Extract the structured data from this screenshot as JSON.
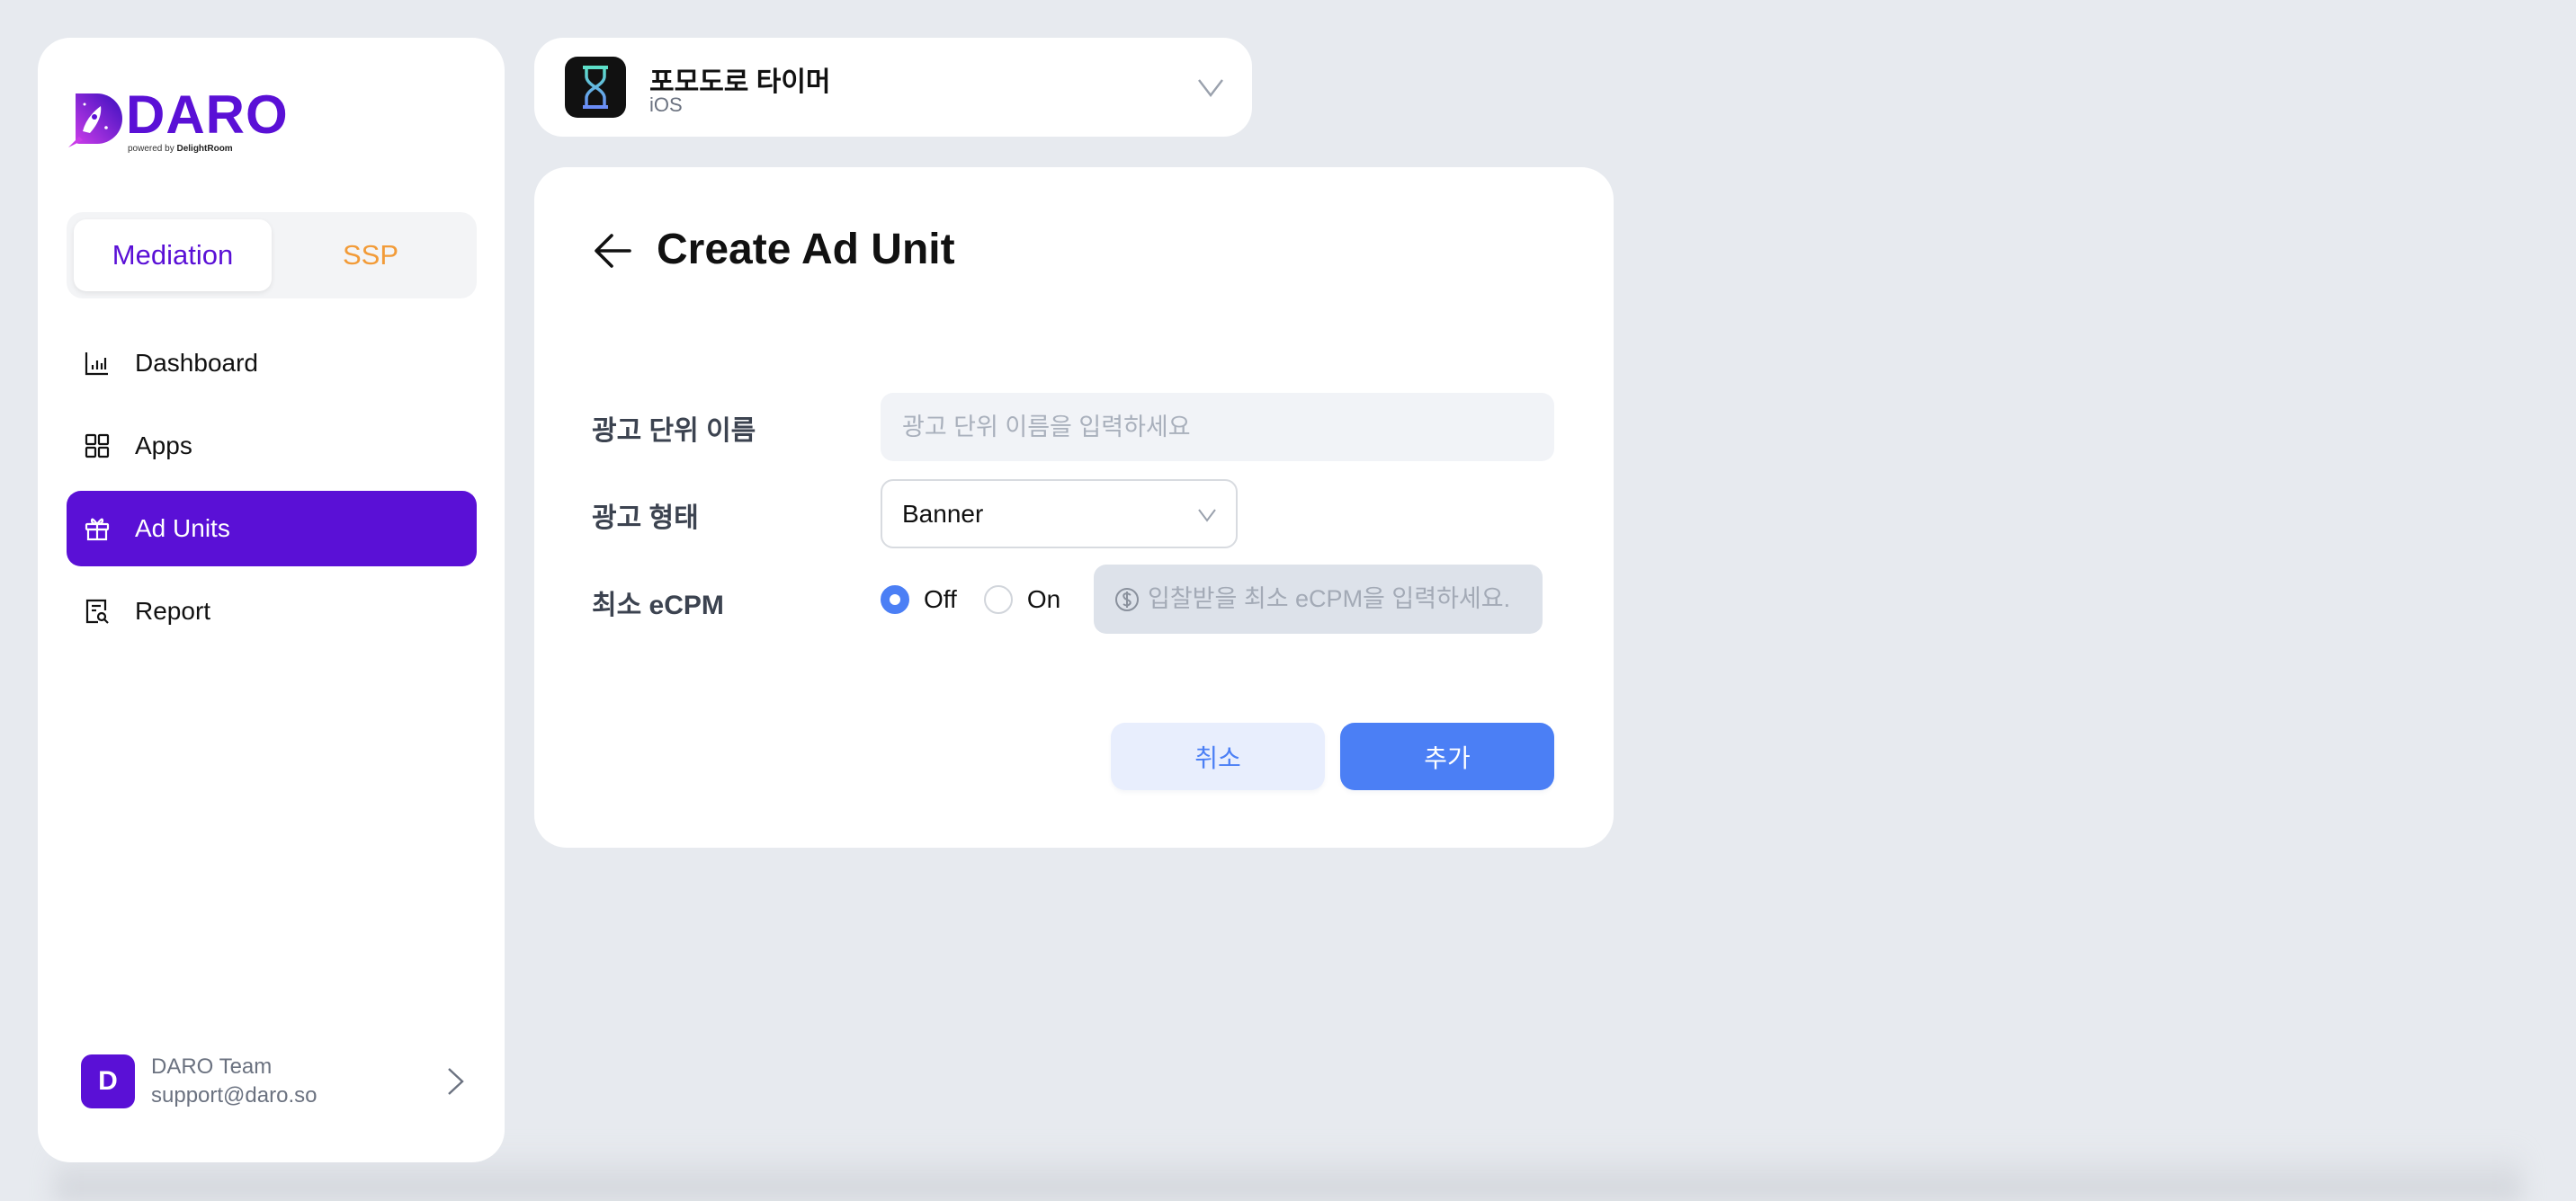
{
  "brand": {
    "name": "DARO",
    "tagline_prefix": "powered by",
    "tagline_company": "DelightRoom",
    "primary_color": "#5a10d6",
    "accent_color": "#4b7ff5",
    "ssp_color": "#f29b38"
  },
  "sidebar": {
    "segment": {
      "options": [
        {
          "label": "Mediation",
          "active": true
        },
        {
          "label": "SSP",
          "active": false
        }
      ]
    },
    "items": [
      {
        "label": "Dashboard",
        "icon": "bar-chart-icon",
        "active": false
      },
      {
        "label": "Apps",
        "icon": "grid-icon",
        "active": false
      },
      {
        "label": "Ad Units",
        "icon": "gift-icon",
        "active": true
      },
      {
        "label": "Report",
        "icon": "report-search-icon",
        "active": false
      }
    ],
    "user": {
      "avatar_letter": "D",
      "name": "DARO Team",
      "email": "support@daro.so"
    }
  },
  "app_selector": {
    "name": "포모도로 타이머",
    "platform": "iOS",
    "icon": "hourglass-icon"
  },
  "page": {
    "title": "Create Ad Unit",
    "form": {
      "name_label": "광고 단위 이름",
      "name_value": "",
      "name_placeholder": "광고 단위 이름을 입력하세요",
      "type_label": "광고 형태",
      "type_value": "Banner",
      "ecpm_label": "최소 eCPM",
      "ecpm_options": [
        {
          "label": "Off",
          "checked": true
        },
        {
          "label": "On",
          "checked": false
        }
      ],
      "ecpm_value": "",
      "ecpm_placeholder": "입찰받을 최소 eCPM을 입력하세요."
    },
    "buttons": {
      "cancel": "취소",
      "add": "추가"
    }
  }
}
